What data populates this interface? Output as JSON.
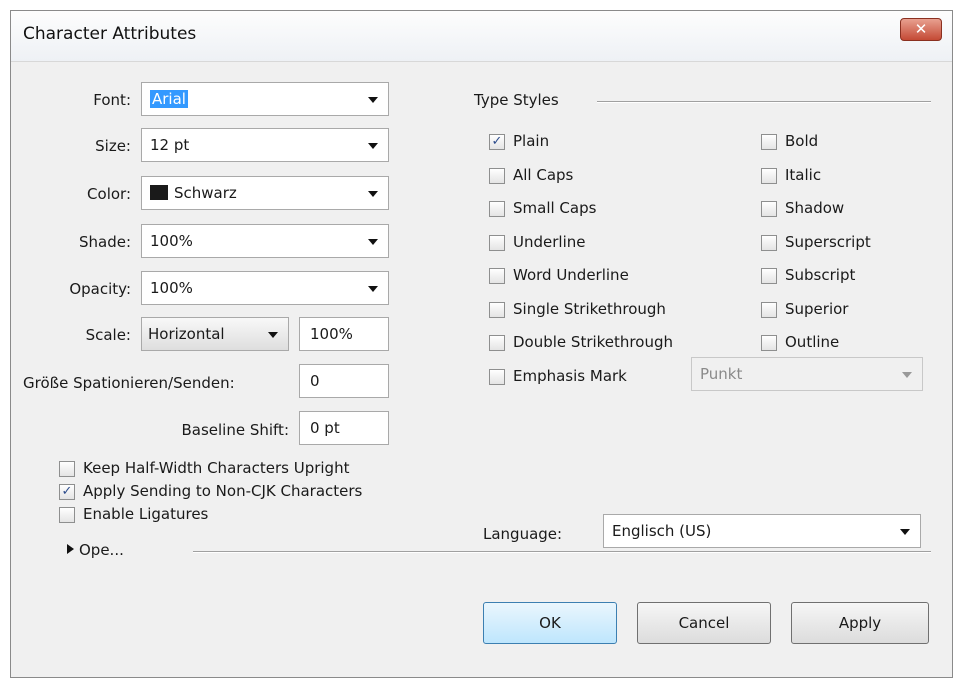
{
  "window": {
    "title": "Character Attributes",
    "close_glyph": "✕"
  },
  "font": {
    "label": "Font:",
    "value": "Arial"
  },
  "size": {
    "label": "Size:",
    "value": "12 pt"
  },
  "color": {
    "label": "Color:",
    "value": "Schwarz",
    "swatch": "#1a1a1a"
  },
  "shade": {
    "label": "Shade:",
    "value": "100%"
  },
  "opacity": {
    "label": "Opacity:",
    "value": "100%"
  },
  "scale": {
    "label": "Scale:",
    "mode": "Horizontal",
    "value": "100%"
  },
  "tracking": {
    "label": "Größe Spationieren/Senden:",
    "value": "0"
  },
  "baseline": {
    "label": "Baseline Shift:",
    "value": "0 pt"
  },
  "options": {
    "keep_half_width": {
      "label": "Keep Half-Width Characters Upright",
      "checked": false
    },
    "apply_sending": {
      "label": "Apply Sending to Non-CJK Characters",
      "checked": true
    },
    "ligatures": {
      "label": "Enable Ligatures",
      "checked": false
    }
  },
  "opentype": {
    "label": "Ope..."
  },
  "type_styles": {
    "heading": "Type Styles",
    "left": [
      {
        "label": "Plain",
        "checked": true
      },
      {
        "label": "All Caps",
        "checked": false
      },
      {
        "label": "Small Caps",
        "checked": false
      },
      {
        "label": "Underline",
        "checked": false
      },
      {
        "label": "Word Underline",
        "checked": false
      },
      {
        "label": "Single Strikethrough",
        "checked": false
      },
      {
        "label": "Double Strikethrough",
        "checked": false
      },
      {
        "label": "Emphasis Mark",
        "checked": false
      }
    ],
    "right": [
      {
        "label": "Bold",
        "checked": false
      },
      {
        "label": "Italic",
        "checked": false
      },
      {
        "label": "Shadow",
        "checked": false
      },
      {
        "label": "Superscript",
        "checked": false
      },
      {
        "label": "Subscript",
        "checked": false
      },
      {
        "label": "Superior",
        "checked": false
      },
      {
        "label": "Outline",
        "checked": false
      }
    ],
    "emphasis_value": "Punkt"
  },
  "language": {
    "label": "Language:",
    "value": "Englisch (US)"
  },
  "buttons": {
    "ok": "OK",
    "cancel": "Cancel",
    "apply": "Apply"
  },
  "check_glyph": "✓"
}
